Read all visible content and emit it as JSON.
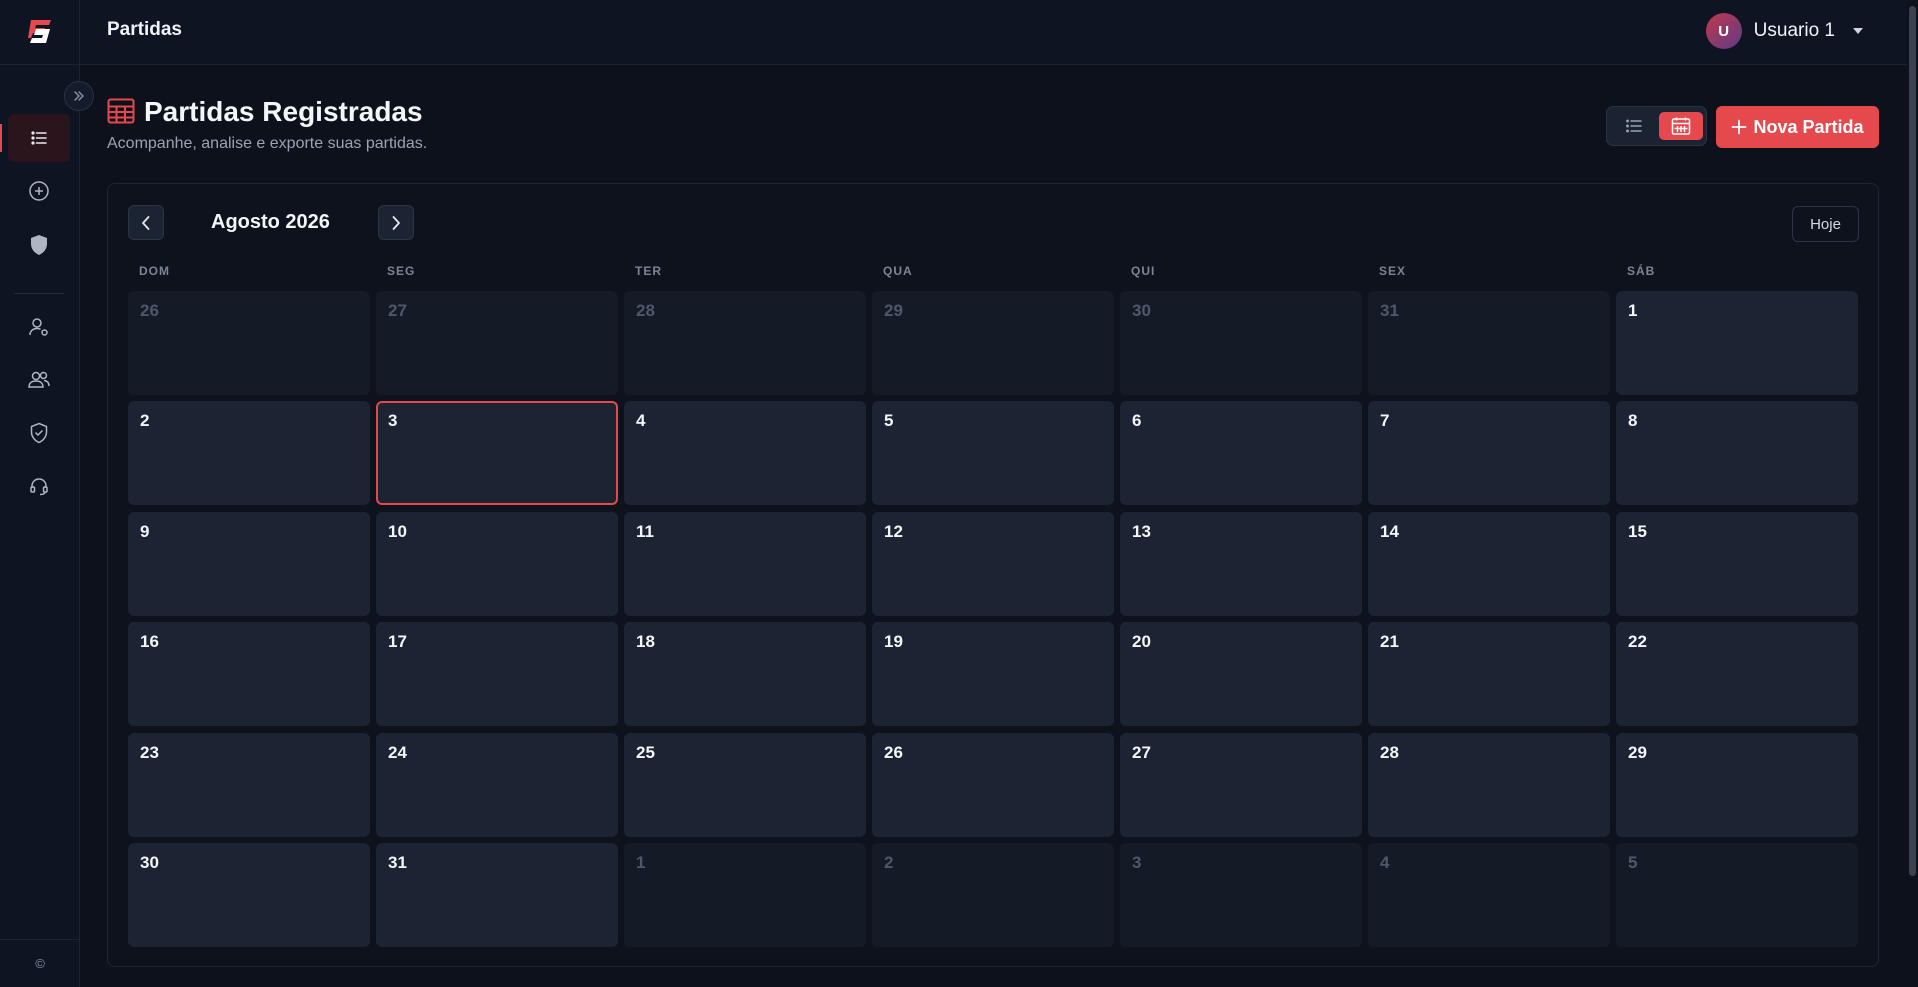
{
  "topbar": {
    "title": "Partidas"
  },
  "user": {
    "initial": "U",
    "name": "Usuario 1"
  },
  "sidebar": {
    "items": [
      {
        "name": "sidebar-item-partidas",
        "icon": "list-icon",
        "active": true
      },
      {
        "name": "sidebar-item-nova",
        "icon": "plus-circle-icon"
      },
      {
        "name": "sidebar-item-shield",
        "icon": "shield-icon"
      },
      {
        "name": "sidebar-item-user-settings",
        "icon": "user-gear-icon"
      },
      {
        "name": "sidebar-item-users",
        "icon": "users-icon"
      },
      {
        "name": "sidebar-item-security",
        "icon": "shield-check-icon"
      },
      {
        "name": "sidebar-item-support",
        "icon": "headset-icon"
      }
    ],
    "footer": "©"
  },
  "header": {
    "title": "Partidas Registradas",
    "subtitle": "Acompanhe, analise e exporte suas partidas.",
    "new_button": "Nova Partida"
  },
  "calendar": {
    "month_label": "Agosto 2026",
    "today_button": "Hoje",
    "weekdays": [
      "DOM",
      "SEG",
      "TER",
      "QUA",
      "QUI",
      "SEX",
      "SÁB"
    ],
    "weeks": [
      [
        {
          "d": "26",
          "m": true
        },
        {
          "d": "27",
          "m": true
        },
        {
          "d": "28",
          "m": true
        },
        {
          "d": "29",
          "m": true
        },
        {
          "d": "30",
          "m": true
        },
        {
          "d": "31",
          "m": true
        },
        {
          "d": "1"
        }
      ],
      [
        {
          "d": "2"
        },
        {
          "d": "3",
          "today": true
        },
        {
          "d": "4"
        },
        {
          "d": "5"
        },
        {
          "d": "6"
        },
        {
          "d": "7"
        },
        {
          "d": "8"
        }
      ],
      [
        {
          "d": "9"
        },
        {
          "d": "10"
        },
        {
          "d": "11"
        },
        {
          "d": "12"
        },
        {
          "d": "13"
        },
        {
          "d": "14"
        },
        {
          "d": "15"
        }
      ],
      [
        {
          "d": "16"
        },
        {
          "d": "17"
        },
        {
          "d": "18"
        },
        {
          "d": "19"
        },
        {
          "d": "20"
        },
        {
          "d": "21"
        },
        {
          "d": "22"
        }
      ],
      [
        {
          "d": "23"
        },
        {
          "d": "24"
        },
        {
          "d": "25"
        },
        {
          "d": "26"
        },
        {
          "d": "27"
        },
        {
          "d": "28"
        },
        {
          "d": "29"
        }
      ],
      [
        {
          "d": "30"
        },
        {
          "d": "31"
        },
        {
          "d": "1",
          "m": true
        },
        {
          "d": "2",
          "m": true
        },
        {
          "d": "3",
          "m": true
        },
        {
          "d": "4",
          "m": true
        },
        {
          "d": "5",
          "m": true
        }
      ]
    ]
  },
  "colors": {
    "accent": "#e5484d",
    "background": "#0c111b",
    "cell": "#1c2333"
  }
}
